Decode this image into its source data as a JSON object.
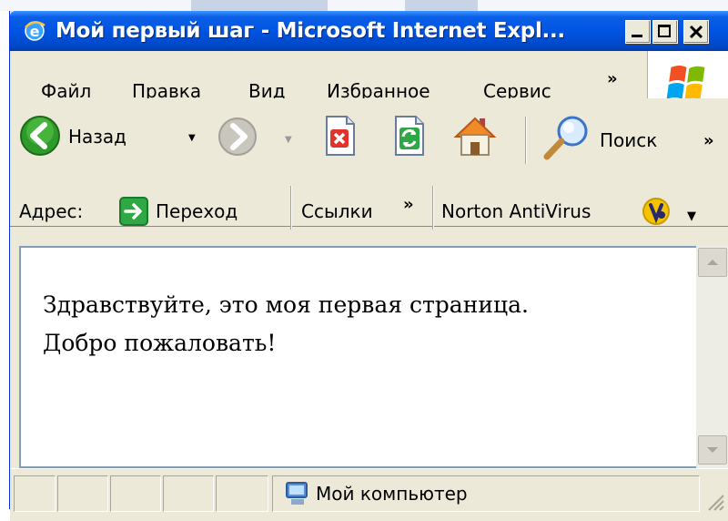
{
  "window": {
    "title": "Мой первый шаг - Microsoft Internet Expl..."
  },
  "menu": {
    "items": [
      {
        "label": "Файл"
      },
      {
        "label": "Правка"
      },
      {
        "label": "Вид"
      },
      {
        "label": "Избранное"
      },
      {
        "label": "Сервис"
      }
    ],
    "more": "»"
  },
  "toolbar": {
    "back_label": "Назад",
    "search_label": "Поиск",
    "more": "»"
  },
  "address_bar": {
    "address_label": "Адрес:",
    "go_label": "Переход",
    "links_label": "Ссылки",
    "links_more": "»",
    "norton_label": "Norton AntiVirus"
  },
  "page": {
    "line1": "Здравствуйте, это моя первая страница.",
    "line2": "Добро пожаловать!"
  },
  "status": {
    "zone": "Мой компьютер"
  },
  "colors": {
    "titlebar": "#0054e3",
    "chrome": "#ece9d8",
    "nav_green": "#2f9e2f"
  }
}
